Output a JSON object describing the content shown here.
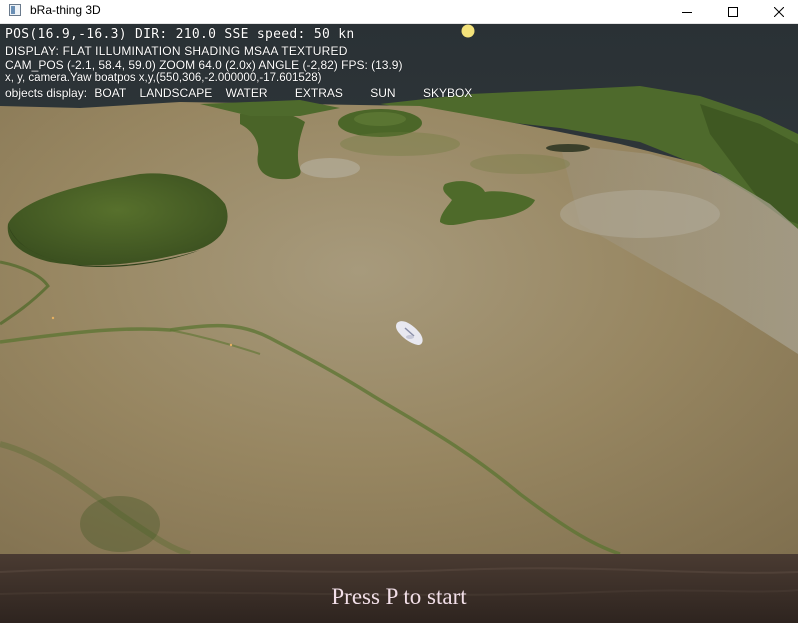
{
  "window": {
    "title": "bRa-thing 3D",
    "icon": "app-window-icon",
    "controls": [
      "minimize-icon",
      "maximize-icon",
      "close-icon"
    ]
  },
  "hud": {
    "position_line": "POS(16.9,-16.3) DIR: 210.0 SSE speed: 50 kn",
    "display_line": "DISPLAY: FLAT ILLUMINATION SHADING MSAA TEXTURED",
    "camera_line": "CAM_POS (-2.1, 58.4, 59.0) ZOOM 64.0 (2.0x) ANGLE (-2,82) FPS: (13.9)",
    "boatpos_line": "x, y, camera.Yaw boatpos x,y,(550,306,-2.000000,-17.601528)",
    "objects_label": "objects display:",
    "objects": [
      "BOAT",
      "LANDSCAPE",
      "WATER",
      "EXTRAS",
      "SUN",
      "SKYBOX"
    ]
  },
  "scene": {
    "sun_color": "#f3e27a",
    "terrain_color": "#9b8a6b",
    "hill_color": "#4f6a2a",
    "sky_color": "#2d3438",
    "foreground_color": "#3a2d26",
    "boat_color": "#e8e8f0"
  },
  "start_prompt": "Press P to start"
}
